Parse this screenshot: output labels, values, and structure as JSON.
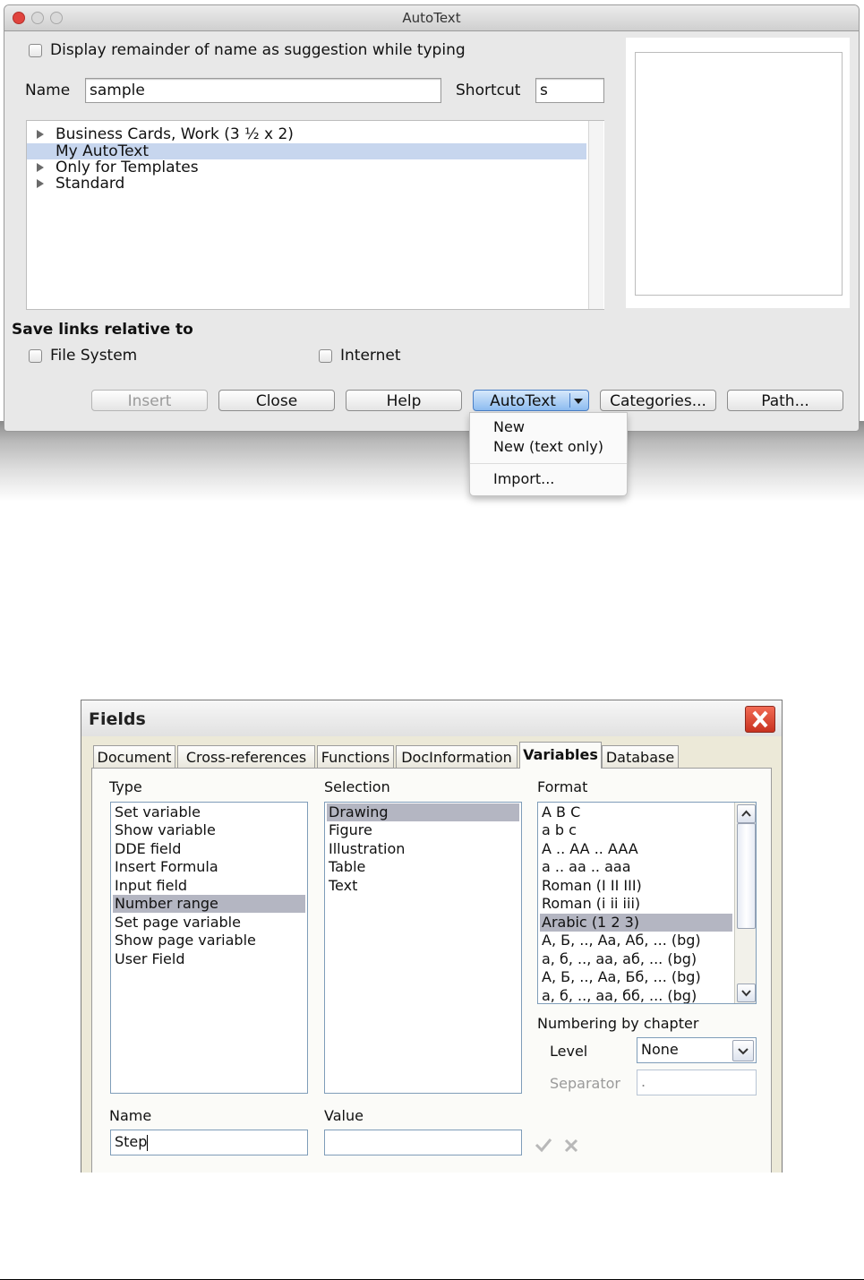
{
  "autotext": {
    "title": "AutoText",
    "display_remainder_label": "Display remainder of name as suggestion while typing",
    "name_label": "Name",
    "name_value": "sample",
    "shortcut_label": "Shortcut",
    "shortcut_value": "s",
    "categories": [
      {
        "label": "Business Cards, Work (3 ½ x 2)",
        "expandable": true
      },
      {
        "label": "My AutoText",
        "expandable": false,
        "selected": true
      },
      {
        "label": "Only for Templates",
        "expandable": true
      },
      {
        "label": "Standard",
        "expandable": true
      }
    ],
    "save_links_label": "Save links relative to",
    "file_system_label": "File System",
    "internet_label": "Internet",
    "buttons": {
      "insert": "Insert",
      "close": "Close",
      "help": "Help",
      "autotext": "AutoText",
      "categories": "Categories...",
      "path": "Path..."
    },
    "menu": {
      "new": "New",
      "new_text_only": "New (text only)",
      "import": "Import..."
    }
  },
  "fields": {
    "title": "Fields",
    "tabs": [
      "Document",
      "Cross-references",
      "Functions",
      "DocInformation",
      "Variables",
      "Database"
    ],
    "active_tab": "Variables",
    "type_label": "Type",
    "selection_label": "Selection",
    "format_label": "Format",
    "types": [
      "Set variable",
      "Show variable",
      "DDE field",
      "Insert Formula",
      "Input field",
      "Number range",
      "Set page variable",
      "Show page variable",
      "User Field"
    ],
    "selected_type": "Number range",
    "selections": [
      "Drawing",
      "Figure",
      "Illustration",
      "Table",
      "Text"
    ],
    "selected_selection": "Drawing",
    "formats": [
      "A B C",
      "a b c",
      "A .. AA .. AAA",
      "a .. aa .. aaa",
      "Roman (I II III)",
      "Roman (i ii iii)",
      "Arabic (1 2 3)",
      "А, Б, .., Аа, Аб, ... (bg)",
      "а, б, .., аа, аб, ... (bg)",
      "А, Б, .., Аа, Бб, ... (bg)",
      "а, б, .., аа, бб, ... (bg)"
    ],
    "selected_format": "Arabic (1 2 3)",
    "numbering_by_chapter_label": "Numbering by chapter",
    "level_label": "Level",
    "level_value": "None",
    "separator_label": "Separator",
    "separator_value": ".",
    "name_label": "Name",
    "name_value": "Step",
    "value_label": "Value",
    "value_value": ""
  }
}
